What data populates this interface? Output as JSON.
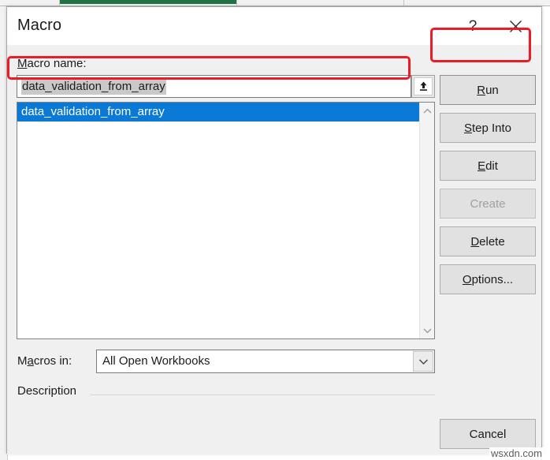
{
  "backdrop": {
    "app": "Excel",
    "active_column_color": "#217346",
    "grid_line_color": "#e4e4e4"
  },
  "dialog": {
    "title": "Macro",
    "help_icon": "question-mark-icon",
    "close_icon": "close-x-icon",
    "macro_name_label": "Macro name:",
    "macro_name_label_accel": "M",
    "macro_name_value": "data_validation_from_array",
    "macro_name_placeholder": "",
    "upload_icon": "upload-arrow-icon",
    "list_items": [
      {
        "label": "data_validation_from_array",
        "selected": true
      }
    ],
    "scrollbar": {
      "up_icon": "chevron-up-icon",
      "down_icon": "chevron-down-icon"
    },
    "macros_in_label": "Macros in:",
    "macros_in_label_accel": "a",
    "macros_in_value": "All Open Workbooks",
    "macros_in_options": [
      "All Open Workbooks"
    ],
    "macros_in_arrow_icon": "chevron-down-icon",
    "description_label": "Description",
    "description_text": "",
    "buttons": {
      "run": {
        "label": "Run",
        "accel": "R",
        "enabled": true,
        "highlighted": true
      },
      "step_into": {
        "label": "Step Into",
        "accel": "S",
        "enabled": true
      },
      "edit": {
        "label": "Edit",
        "accel": "E",
        "enabled": true
      },
      "create": {
        "label": "Create",
        "accel": "",
        "enabled": false
      },
      "delete": {
        "label": "Delete",
        "accel": "D",
        "enabled": true
      },
      "options": {
        "label": "Options...",
        "accel": "O",
        "enabled": true
      },
      "cancel": {
        "label": "Cancel",
        "accel": "",
        "enabled": true
      }
    }
  },
  "annotations": {
    "color": "#ed1c24",
    "targets": [
      "run-button",
      "selected-list-item"
    ]
  },
  "watermark": "wsxdn.com",
  "colors": {
    "selection_blue": "#0a7ad6",
    "dialog_background": "#f0f0f0",
    "button_face": "#e1e1e1",
    "annotation_red": "#ed1c24",
    "excel_green": "#217346"
  }
}
